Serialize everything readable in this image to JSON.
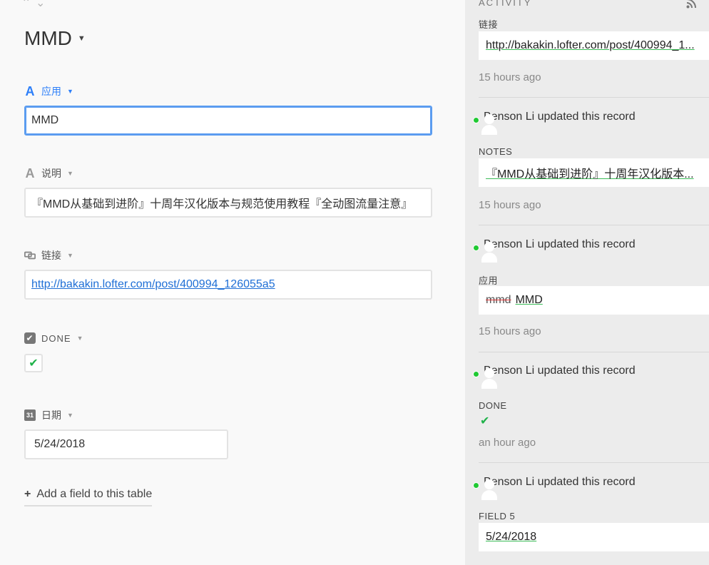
{
  "record": {
    "title": "MMD",
    "nav_up": "⌃",
    "nav_down": "⌄"
  },
  "fields": {
    "app": {
      "label": "应用",
      "value": "MMD"
    },
    "notes": {
      "label": "说明",
      "value": "『MMD从基础到进阶』十周年汉化版本与规范使用教程『全动图流量注意』"
    },
    "link": {
      "label": "链接",
      "value": "http://bakakin.lofter.com/post/400994_126055a5"
    },
    "done": {
      "label": "DONE",
      "checked": "✔"
    },
    "date": {
      "label": "日期",
      "value": "5/24/2018",
      "icon_text": "31"
    }
  },
  "add_field": {
    "label": "Add a field to this table"
  },
  "activity": {
    "header": "ACTIVITY",
    "top_label": "链接",
    "top_value": "http://bakakin.lofter.com/post/400994_1...",
    "top_time": "15 hours ago",
    "entries": [
      {
        "user": "Benson Li updated this record",
        "field": "NOTES",
        "value": "『MMD从基础到进阶』十周年汉化版本...",
        "time": "15 hours ago"
      },
      {
        "user": "Benson Li updated this record",
        "field": "应用",
        "removed": "mmd",
        "value": "MMD",
        "time": "15 hours ago"
      },
      {
        "user": "Benson Li updated this record",
        "field": "DONE",
        "check": "✔",
        "time": "an hour ago"
      },
      {
        "user": "Benson Li updated this record",
        "field": "FIELD 5",
        "value": "5/24/2018"
      }
    ]
  },
  "colors": {
    "accent": "#2d7ff9",
    "success": "#20b24a",
    "avatar": "#f0c419"
  },
  "icons": [
    "chevron-up-icon",
    "chevron-down-icon",
    "caret-down-icon",
    "text-field-icon",
    "link-field-icon",
    "checkbox-field-icon",
    "calendar-icon",
    "plus-icon",
    "rss-icon",
    "avatar-icon",
    "checkmark-icon"
  ]
}
